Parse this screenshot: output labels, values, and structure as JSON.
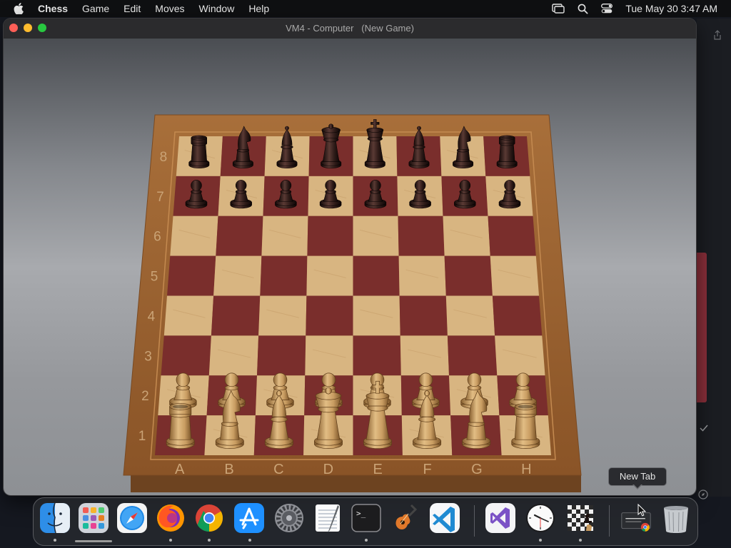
{
  "menubar": {
    "app_name": "Chess",
    "items": [
      "Game",
      "Edit",
      "Moves",
      "Window",
      "Help"
    ],
    "clock": "Tue May 30  3:47 AM"
  },
  "window": {
    "title": "VM4 - Computer   (New Game)"
  },
  "board": {
    "files": [
      "A",
      "B",
      "C",
      "D",
      "E",
      "F",
      "G",
      "H"
    ],
    "ranks": [
      "1",
      "2",
      "3",
      "4",
      "5",
      "6",
      "7",
      "8"
    ],
    "position": {
      "black_back": [
        "rook",
        "knight",
        "bishop",
        "queen",
        "king",
        "bishop",
        "knight",
        "rook"
      ],
      "black_pawns": 8,
      "white_pawns": 8,
      "white_back": [
        "rook",
        "knight",
        "bishop",
        "queen",
        "king",
        "bishop",
        "knight",
        "rook"
      ]
    },
    "colors": {
      "light_square": "#d8b581",
      "dark_square": "#7a2e2c",
      "frame": "#9b6632",
      "white_piece": "#c89a5e",
      "black_piece": "#2a1715"
    }
  },
  "dock": {
    "tooltip": "New Tab",
    "apps": [
      {
        "name": "Finder",
        "icon": "finder-icon"
      },
      {
        "name": "Launchpad",
        "icon": "launchpad-icon"
      },
      {
        "name": "Safari",
        "icon": "safari-icon"
      },
      {
        "name": "Firefox",
        "icon": "firefox-icon"
      },
      {
        "name": "Chrome",
        "icon": "chrome-icon"
      },
      {
        "name": "App Store",
        "icon": "app-store-icon"
      },
      {
        "name": "System Settings",
        "icon": "settings-gear-icon"
      },
      {
        "name": "TextEdit",
        "icon": "textedit-icon"
      },
      {
        "name": "Terminal",
        "icon": "terminal-icon",
        "glyph": ">_"
      },
      {
        "name": "GarageBand",
        "icon": "guitar-icon"
      },
      {
        "name": "VS Code",
        "icon": "vscode-icon"
      },
      {
        "name": "Visual Studio",
        "icon": "visual-studio-icon"
      },
      {
        "name": "Clock",
        "icon": "clock-icon"
      },
      {
        "name": "Chess",
        "icon": "chess-icon"
      },
      {
        "name": "Chrome Window",
        "icon": "chrome-window-icon"
      },
      {
        "name": "Trash",
        "icon": "trash-icon"
      }
    ]
  }
}
